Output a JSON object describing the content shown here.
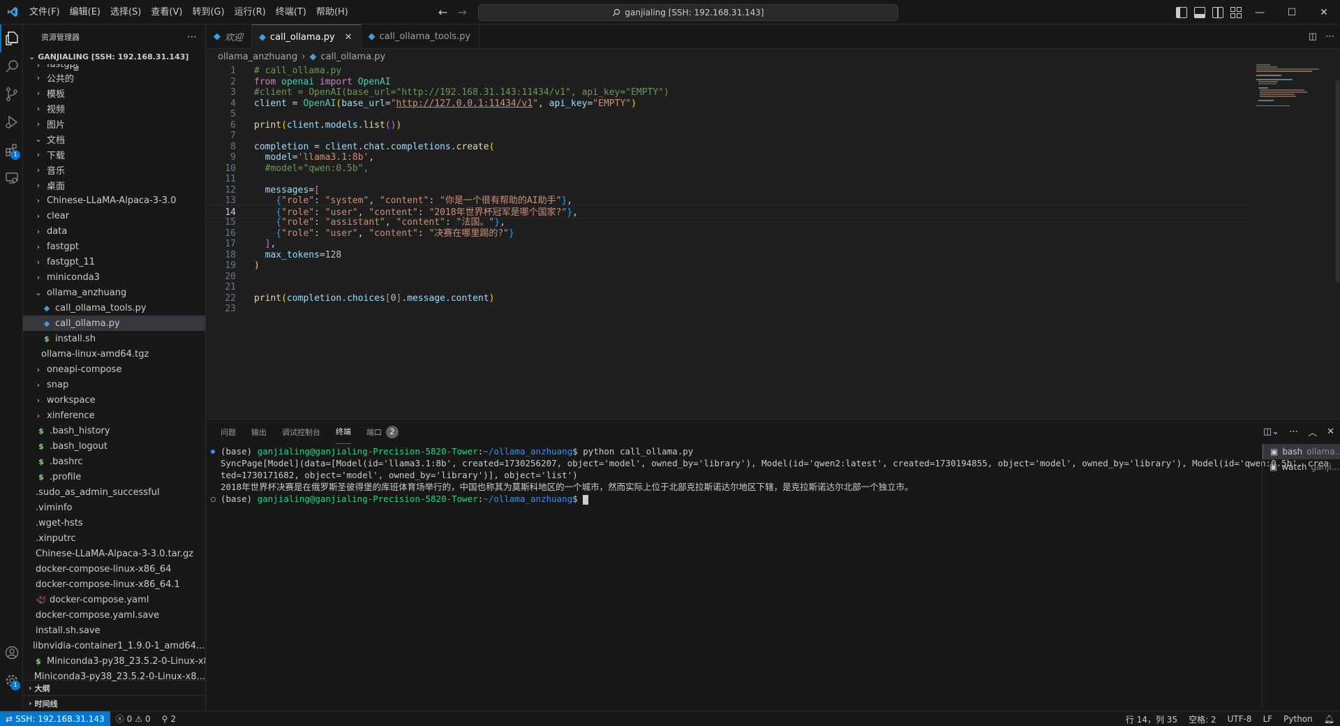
{
  "titlebar": {
    "menus": [
      "文件(F)",
      "编辑(E)",
      "选择(S)",
      "查看(V)",
      "转到(G)",
      "运行(R)",
      "终端(T)",
      "帮助(H)"
    ],
    "search": "ganjialing [SSH: 192.168.31.143]"
  },
  "activity": {
    "extensions_badge": "1",
    "settings_badge": "1"
  },
  "sidebar": {
    "title": "资源管理器",
    "workspace": "GANJIALING [SSH: 192.168.31.143]",
    "items": [
      {
        "label": "fastgpt",
        "type": "folder",
        "depth": 0,
        "expanded": false
      },
      {
        "label": "公共的",
        "type": "folder",
        "depth": 0,
        "expanded": false
      },
      {
        "label": "模板",
        "type": "folder",
        "depth": 0,
        "expanded": false
      },
      {
        "label": "视频",
        "type": "folder",
        "depth": 0,
        "expanded": false
      },
      {
        "label": "图片",
        "type": "folder",
        "depth": 0,
        "expanded": false
      },
      {
        "label": "文档",
        "type": "folder",
        "depth": 0,
        "expanded": true
      },
      {
        "label": "下载",
        "type": "folder",
        "depth": 0,
        "expanded": false
      },
      {
        "label": "音乐",
        "type": "folder",
        "depth": 0,
        "expanded": false
      },
      {
        "label": "桌面",
        "type": "folder",
        "depth": 0,
        "expanded": false
      },
      {
        "label": "Chinese-LLaMA-Alpaca-3-3.0",
        "type": "folder",
        "depth": 0,
        "expanded": false
      },
      {
        "label": "clear",
        "type": "folder",
        "depth": 0,
        "expanded": false
      },
      {
        "label": "data",
        "type": "folder",
        "depth": 0,
        "expanded": false
      },
      {
        "label": "fastgpt",
        "type": "folder",
        "depth": 0,
        "expanded": false
      },
      {
        "label": "fastgpt_11",
        "type": "folder",
        "depth": 0,
        "expanded": false
      },
      {
        "label": "miniconda3",
        "type": "folder",
        "depth": 0,
        "expanded": false
      },
      {
        "label": "ollama_anzhuang",
        "type": "folder",
        "depth": 0,
        "expanded": true
      },
      {
        "label": "call_ollama_tools.py",
        "type": "py",
        "depth": 1
      },
      {
        "label": "call_ollama.py",
        "type": "py",
        "depth": 1,
        "selected": true
      },
      {
        "label": "install.sh",
        "type": "sh",
        "depth": 1
      },
      {
        "label": "ollama-linux-amd64.tgz",
        "type": "txt",
        "depth": 1
      },
      {
        "label": "oneapi-compose",
        "type": "folder",
        "depth": 0,
        "expanded": false
      },
      {
        "label": "snap",
        "type": "folder",
        "depth": 0,
        "expanded": false
      },
      {
        "label": "workspace",
        "type": "folder",
        "depth": 0,
        "expanded": false
      },
      {
        "label": "xinference",
        "type": "folder",
        "depth": 0,
        "expanded": false
      },
      {
        "label": ".bash_history",
        "type": "sh",
        "depth": 0
      },
      {
        "label": ".bash_logout",
        "type": "sh",
        "depth": 0
      },
      {
        "label": ".bashrc",
        "type": "sh",
        "depth": 0
      },
      {
        "label": ".profile",
        "type": "sh",
        "depth": 0
      },
      {
        "label": ".sudo_as_admin_successful",
        "type": "txt",
        "depth": 0
      },
      {
        "label": ".viminfo",
        "type": "txt",
        "depth": 0
      },
      {
        "label": ".wget-hsts",
        "type": "txt",
        "depth": 0
      },
      {
        "label": ".xinputrc",
        "type": "txt",
        "depth": 0
      },
      {
        "label": "Chinese-LLaMA-Alpaca-3-3.0.tar.gz",
        "type": "txt",
        "depth": 0
      },
      {
        "label": "docker-compose-linux-x86_64",
        "type": "txt",
        "depth": 0
      },
      {
        "label": "docker-compose-linux-x86_64.1",
        "type": "txt",
        "depth": 0
      },
      {
        "label": "docker-compose.yaml",
        "type": "docker",
        "depth": 0
      },
      {
        "label": "docker-compose.yaml.save",
        "type": "txt",
        "depth": 0
      },
      {
        "label": "install.sh.save",
        "type": "txt",
        "depth": 0
      },
      {
        "label": "libnvidia-container1_1.9.0-1_amd64....",
        "type": "txt",
        "depth": 0
      },
      {
        "label": "Miniconda3-py38_23.5.2-0-Linux-x8...",
        "type": "sh",
        "depth": 0
      },
      {
        "label": "Miniconda3-py38_23.5.2-0-Linux-x8...",
        "type": "txt",
        "depth": 0
      }
    ],
    "outline": "大纲",
    "timeline": "时间线"
  },
  "editor": {
    "tabs": [
      {
        "label": "欢迎",
        "active": false
      },
      {
        "label": "call_ollama.py",
        "active": true
      },
      {
        "label": "call_ollama_tools.py",
        "active": false
      }
    ],
    "breadcrumb": [
      "ollama_anzhuang",
      "call_ollama.py"
    ],
    "current_line": 14,
    "lines": [
      [
        [
          "c-comment",
          "# call_ollama.py"
        ]
      ],
      [
        [
          "c-kw",
          "from"
        ],
        [
          "c-plain",
          " "
        ],
        [
          "c-cls",
          "openai"
        ],
        [
          "c-plain",
          " "
        ],
        [
          "c-kw",
          "import"
        ],
        [
          "c-plain",
          " "
        ],
        [
          "c-cls",
          "OpenAI"
        ]
      ],
      [
        [
          "c-comment",
          "#client = OpenAI(base_url=\"http://192.168.31.143:11434/v1\", api_key=\"EMPTY\")"
        ]
      ],
      [
        [
          "c-var",
          "client"
        ],
        [
          "c-plain",
          " = "
        ],
        [
          "c-cls",
          "OpenAI"
        ],
        [
          "c-br1",
          "("
        ],
        [
          "c-var",
          "base_url"
        ],
        [
          "c-plain",
          "="
        ],
        [
          "c-str",
          "\""
        ],
        [
          "c-url",
          "http://127.0.0.1:11434/v1"
        ],
        [
          "c-str",
          "\""
        ],
        [
          "c-plain",
          ", "
        ],
        [
          "c-var",
          "api_key"
        ],
        [
          "c-plain",
          "="
        ],
        [
          "c-str",
          "\"EMPTY\""
        ],
        [
          "c-br1",
          ")"
        ]
      ],
      [],
      [
        [
          "c-fn",
          "print"
        ],
        [
          "c-br1",
          "("
        ],
        [
          "c-var",
          "client"
        ],
        [
          "c-plain",
          "."
        ],
        [
          "c-var",
          "models"
        ],
        [
          "c-plain",
          "."
        ],
        [
          "c-fn",
          "list"
        ],
        [
          "c-br2",
          "()"
        ],
        [
          "c-br1",
          ")"
        ]
      ],
      [],
      [
        [
          "c-var",
          "completion"
        ],
        [
          "c-plain",
          " = "
        ],
        [
          "c-var",
          "client"
        ],
        [
          "c-plain",
          "."
        ],
        [
          "c-var",
          "chat"
        ],
        [
          "c-plain",
          "."
        ],
        [
          "c-var",
          "completions"
        ],
        [
          "c-plain",
          "."
        ],
        [
          "c-fn",
          "create"
        ],
        [
          "c-br1",
          "("
        ]
      ],
      [
        [
          "c-plain",
          "  "
        ],
        [
          "c-var",
          "model"
        ],
        [
          "c-plain",
          "="
        ],
        [
          "c-str",
          "'llama3.1:8b'"
        ],
        [
          "c-plain",
          ","
        ]
      ],
      [
        [
          "c-plain",
          "  "
        ],
        [
          "c-comment",
          "#model=\"qwen:0.5b\","
        ]
      ],
      [],
      [
        [
          "c-plain",
          "  "
        ],
        [
          "c-var",
          "messages"
        ],
        [
          "c-plain",
          "="
        ],
        [
          "c-br2",
          "["
        ]
      ],
      [
        [
          "c-plain",
          "    "
        ],
        [
          "c-br3",
          "{"
        ],
        [
          "c-str",
          "\"role\""
        ],
        [
          "c-plain",
          ": "
        ],
        [
          "c-str",
          "\"system\""
        ],
        [
          "c-plain",
          ", "
        ],
        [
          "c-str",
          "\"content\""
        ],
        [
          "c-plain",
          ": "
        ],
        [
          "c-str",
          "\"你是一个很有帮助的AI助手\""
        ],
        [
          "c-br3",
          "}"
        ],
        [
          "c-plain",
          ","
        ]
      ],
      [
        [
          "c-plain",
          "    "
        ],
        [
          "c-br3",
          "{"
        ],
        [
          "c-str",
          "\"role\""
        ],
        [
          "c-plain",
          ": "
        ],
        [
          "c-str",
          "\"user\""
        ],
        [
          "c-plain",
          ", "
        ],
        [
          "c-str",
          "\"content\""
        ],
        [
          "c-plain",
          ": "
        ],
        [
          "c-str",
          "\"2018年世界杯冠军是哪个国家?\""
        ],
        [
          "c-br3",
          "}"
        ],
        [
          "c-plain",
          ","
        ]
      ],
      [
        [
          "c-plain",
          "    "
        ],
        [
          "c-br3",
          "{"
        ],
        [
          "c-str",
          "\"role\""
        ],
        [
          "c-plain",
          ": "
        ],
        [
          "c-str",
          "\"assistant\""
        ],
        [
          "c-plain",
          ", "
        ],
        [
          "c-str",
          "\"content\""
        ],
        [
          "c-plain",
          ": "
        ],
        [
          "c-str",
          "\"法国。\""
        ],
        [
          "c-br3",
          "}"
        ],
        [
          "c-plain",
          ","
        ]
      ],
      [
        [
          "c-plain",
          "    "
        ],
        [
          "c-br3",
          "{"
        ],
        [
          "c-str",
          "\"role\""
        ],
        [
          "c-plain",
          ": "
        ],
        [
          "c-str",
          "\"user\""
        ],
        [
          "c-plain",
          ", "
        ],
        [
          "c-str",
          "\"content\""
        ],
        [
          "c-plain",
          ": "
        ],
        [
          "c-str",
          "\"决赛在哪里踢的?\""
        ],
        [
          "c-br3",
          "}"
        ]
      ],
      [
        [
          "c-plain",
          "  "
        ],
        [
          "c-br2",
          "]"
        ],
        [
          "c-plain",
          ","
        ]
      ],
      [
        [
          "c-plain",
          "  "
        ],
        [
          "c-var",
          "max_tokens"
        ],
        [
          "c-plain",
          "="
        ],
        [
          "c-num",
          "128"
        ]
      ],
      [
        [
          "c-br1",
          ")"
        ]
      ],
      [],
      [],
      [
        [
          "c-fn",
          "print"
        ],
        [
          "c-br1",
          "("
        ],
        [
          "c-var",
          "completion"
        ],
        [
          "c-plain",
          "."
        ],
        [
          "c-var",
          "choices"
        ],
        [
          "c-br2",
          "["
        ],
        [
          "c-num",
          "0"
        ],
        [
          "c-br2",
          "]"
        ],
        [
          "c-plain",
          "."
        ],
        [
          "c-var",
          "message"
        ],
        [
          "c-plain",
          "."
        ],
        [
          "c-var",
          "content"
        ],
        [
          "c-br1",
          ")"
        ]
      ],
      []
    ]
  },
  "panel": {
    "tabs": [
      {
        "label": "问题",
        "active": false
      },
      {
        "label": "输出",
        "active": false
      },
      {
        "label": "调试控制台",
        "active": false
      },
      {
        "label": "终端",
        "active": true
      },
      {
        "label": "端口",
        "active": false,
        "badge": "2"
      }
    ],
    "terminal": {
      "prompt_env": "(base) ",
      "prompt_user": "ganjialing@ganjialing-Precision-5820-Tower",
      "prompt_path": "~/ollama_anzhuang",
      "command": "$ python call_ollama.py",
      "output1": "SyncPage[Model](data=[Model(id='llama3.1:8b', created=1730256207, object='model', owned_by='library'), Model(id='qwen2:latest', created=1730194855, object='model', owned_by='library'), Model(id='qwen:0.5b', crea",
      "output2": "ted=1730171682, object='model', owned_by='library')], object='list')",
      "output3": "2018年世界杯决赛是在俄罗斯圣彼得堡的库班体育场举行的，中国也称其为莫斯科地区的一个城市，然而实际上位于北部克拉斯诺达尔地区下辖，是克拉斯诺达尔北部一个独立市。",
      "prompt_end": "$ "
    },
    "terminals": [
      {
        "name": "bash",
        "detail": "ollama...",
        "active": true
      },
      {
        "name": "watch",
        "detail": "ganji...",
        "active": false
      }
    ]
  },
  "statusbar": {
    "remote": "SSH: 192.168.31.143",
    "errors": "0",
    "warnings": "0",
    "ports": "2",
    "position": "行 14，列 35",
    "spaces": "空格: 2",
    "encoding": "UTF-8",
    "eol": "LF",
    "language": "Python"
  }
}
